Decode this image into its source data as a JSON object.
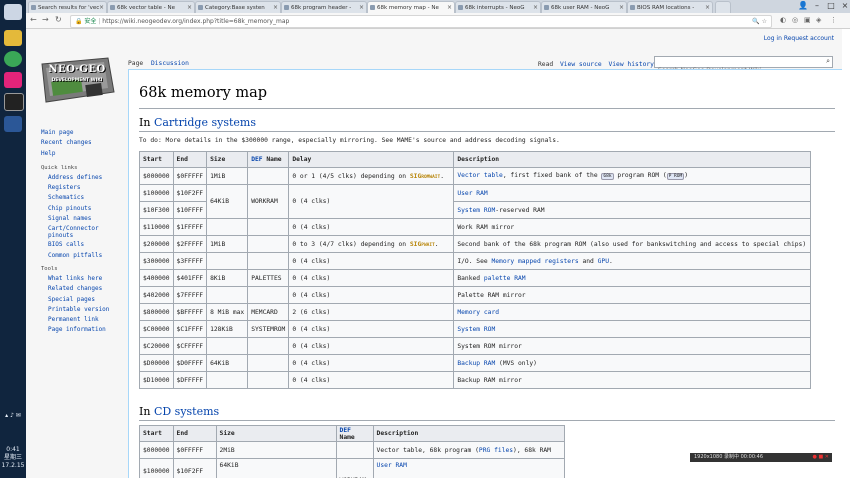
{
  "taskbar": {
    "time": "0:41",
    "weekday": "星期三",
    "date": "17.2.15"
  },
  "tabs": [
    {
      "title": "Search results for 'vec"
    },
    {
      "title": "68k vector table - Ne"
    },
    {
      "title": "Category:Base systen"
    },
    {
      "title": "68k program header -"
    },
    {
      "title": "68k memory map - Ne"
    },
    {
      "title": "68k interrupts - NeoG"
    },
    {
      "title": "68k user RAM - NeoG"
    },
    {
      "title": "BIOS RAM locations -"
    }
  ],
  "address_bar": {
    "secure_label": "安全",
    "url": "https://wiki.neogeodev.org/index.php?title=68k_memory_map"
  },
  "personal": {
    "login": "Log in",
    "request": "Request account"
  },
  "logo": {
    "line1": "NEO·GEO",
    "line2": "DEVELOPMENT WIKI"
  },
  "page_tabs": {
    "page": "Page",
    "discussion": "Discussion",
    "read": "Read",
    "view_source": "View source",
    "view_history": "View history"
  },
  "search": {
    "placeholder": "Search NeoGeo Development Wiki"
  },
  "sidebar": {
    "main": [
      "Main page",
      "Recent changes",
      "Help"
    ],
    "quick_heading": "Quick links",
    "quick": [
      "Address defines",
      "Registers",
      "Schematics",
      "Chip pinouts",
      "Signal names",
      "Cart/Connector pinouts",
      "BIOS calls",
      "Common pitfalls"
    ],
    "tools_heading": "Tools",
    "tools": [
      "What links here",
      "Related changes",
      "Special pages",
      "Printable version",
      "Permanent link",
      "Page information"
    ]
  },
  "page": {
    "title": "68k memory map",
    "section1_prefix": "In ",
    "section1_link": "Cartridge systems",
    "todo": "To do: More details in the $300000 range, especially mirroring. See MAME's source and address decoding signals.",
    "section2_prefix": "In ",
    "section2_link": "CD systems"
  },
  "cart_table": {
    "headers": [
      "Start",
      "End",
      "Size",
      "DEF",
      " Name",
      "Delay",
      "Description"
    ],
    "rows": [
      {
        "start": "$000000",
        "end": "$0FFFFF",
        "size": "1MiB",
        "name": "",
        "delay_pre": "0 or 1 (4/5 clks) depending on ",
        "delay_sig": "SIG",
        "delay_sig2": "ROMWAIT",
        "delay_post": ".",
        "desc_link": "Vector table",
        "desc": ", first fixed bank of the ",
        "chip1": "68k",
        "desc2": " program ROM (",
        "chip2": "P ROM",
        "desc3": ")"
      },
      {
        "start": "$100000",
        "end": "$10F2FF",
        "size": "64KiB",
        "name": "WORKRAM",
        "delay": "0 (4 clks)",
        "desc_link": "User RAM",
        "desc": ""
      },
      {
        "start": "$10F300",
        "end": "$10FFFF",
        "size": "",
        "name": "",
        "delay": "",
        "desc_link": "System ROM",
        "desc": "-reserved RAM"
      },
      {
        "start": "$110000",
        "end": "$1FFFFF",
        "size": "",
        "name": "",
        "delay": "0 (4 clks)",
        "desc_link": "",
        "desc": "Work RAM mirror"
      },
      {
        "start": "$200000",
        "end": "$2FFFFF",
        "size": "1MiB",
        "name": "",
        "delay_pre": "0 to 3 (4/7 clks) depending on ",
        "delay_sig": "SIG",
        "delay_sig2": "PWAIT",
        "delay_post": ".",
        "desc_link": "",
        "desc": "Second bank of the 68k program ROM (also used for bankswitching and access to special chips)"
      },
      {
        "start": "$300000",
        "end": "$3FFFFF",
        "size": "",
        "name": "",
        "delay": "0 (4 clks)",
        "desc_link": "",
        "desc": "I/O. See ",
        "desc_link2": "Memory mapped registers",
        "desc_mid": " and ",
        "desc_link3": "GPU",
        "desc_end": "."
      },
      {
        "start": "$400000",
        "end": "$401FFF",
        "size": "8KiB",
        "name": "PALETTES",
        "delay": "0 (4 clks)",
        "desc_link": "",
        "desc": "Banked ",
        "desc_link2": "palette RAM",
        "desc_mid": "",
        "desc_link3": "",
        "desc_end": ""
      },
      {
        "start": "$402000",
        "end": "$7FFFFF",
        "size": "",
        "name": "",
        "delay": "0 (4 clks)",
        "desc_link": "",
        "desc": "Palette RAM mirror"
      },
      {
        "start": "$800000",
        "end": "$BFFFFF",
        "size": "8 MiB max",
        "name": "MEMCARD",
        "delay": "2 (6 clks)",
        "desc_link": "Memory card",
        "desc": ""
      },
      {
        "start": "$C00000",
        "end": "$C1FFFF",
        "size": "128KiB",
        "name": "SYSTEMROM",
        "delay": "0 (4 clks)",
        "desc_link": "System ROM",
        "desc": ""
      },
      {
        "start": "$C20000",
        "end": "$CFFFFF",
        "size": "",
        "name": "",
        "delay": "0 (4 clks)",
        "desc_link": "",
        "desc": "System ROM mirror"
      },
      {
        "start": "$D00000",
        "end": "$D0FFFF",
        "size": "64KiB",
        "name": "",
        "delay": "0 (4 clks)",
        "desc_link": "Backup RAM",
        "desc": " (MVS only)"
      },
      {
        "start": "$D10000",
        "end": "$DFFFFF",
        "size": "",
        "name": "",
        "delay": "0 (4 clks)",
        "desc_link": "",
        "desc": "Backup RAM mirror"
      }
    ]
  },
  "cd_table": {
    "headers": [
      "Start",
      "End",
      "Size",
      "DEF",
      " Name",
      "Description"
    ],
    "rows": [
      {
        "start": "$000000",
        "end": "$0FFFFF",
        "size": "2MiB",
        "name": "",
        "desc": "Vector table, 68k program (",
        "desc_link": "PRG files",
        "desc2": "), 68k RAM"
      },
      {
        "start": "$100000",
        "end": "$10F2FF",
        "size": "64KiB",
        "name": "WORKRAM",
        "desc": "",
        "desc_link": "User RAM",
        "desc2": ""
      }
    ]
  },
  "overlay": {
    "text": "1920x1080  录制中 00:00:46"
  },
  "colors": {
    "link": "#0645ad",
    "sig": "#b8860b",
    "taskbar": "#10253e"
  }
}
